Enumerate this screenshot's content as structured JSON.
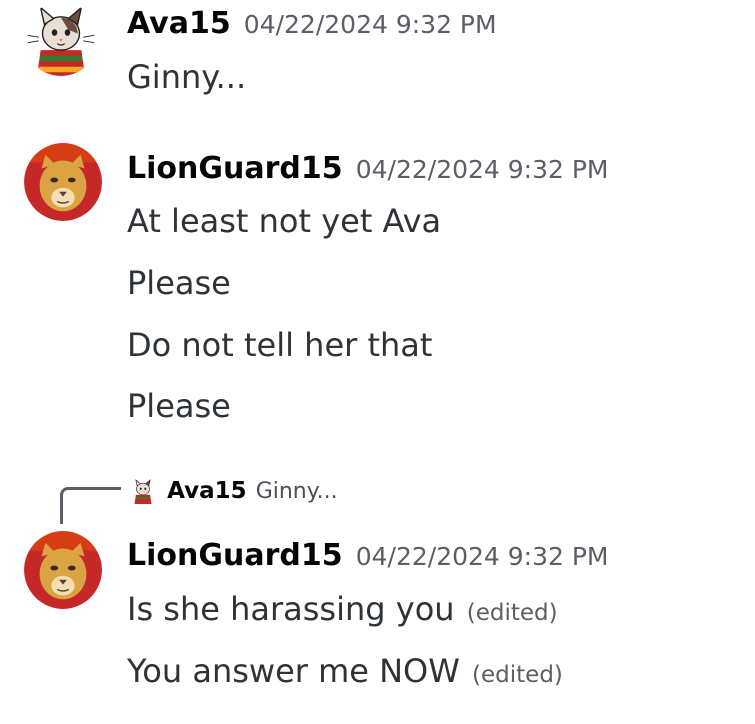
{
  "messages": [
    {
      "user": "Ava15",
      "timestamp": "04/22/2024 9:32 PM",
      "avatar_icon": "cat-in-scarf-avatar",
      "lines": [
        "Ginny..."
      ]
    },
    {
      "user": "LionGuard15",
      "timestamp": "04/22/2024 9:32 PM",
      "avatar_icon": "lioness-avatar",
      "lines": [
        "At least not yet Ava",
        "Please",
        "Do not tell her that",
        "Please"
      ]
    },
    {
      "reply_to": {
        "user": "Ava15",
        "text": "Ginny...",
        "avatar_icon": "cat-in-scarf-avatar"
      },
      "user": "LionGuard15",
      "timestamp": "04/22/2024 9:32 PM",
      "avatar_icon": "lioness-avatar",
      "lines": [
        {
          "text": "Is she harassing you",
          "edited": "(edited)"
        },
        {
          "text": "You answer me NOW",
          "edited": "(edited)"
        }
      ]
    }
  ],
  "colors": {
    "username": "#060607",
    "timestamp": "#5c5e66",
    "message_text": "#2e3338",
    "background": "#ffffff"
  }
}
